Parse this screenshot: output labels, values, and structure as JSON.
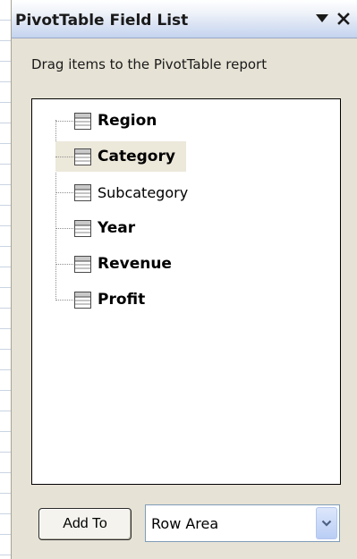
{
  "pane": {
    "title": "PivotTable Field List",
    "instructions": "Drag items to the PivotTable report"
  },
  "fields": [
    {
      "label": "Region",
      "bold": true,
      "selected": false
    },
    {
      "label": "Category",
      "bold": true,
      "selected": true
    },
    {
      "label": "Subcategory",
      "bold": false,
      "selected": false
    },
    {
      "label": "Year",
      "bold": true,
      "selected": false
    },
    {
      "label": "Revenue",
      "bold": true,
      "selected": false
    },
    {
      "label": "Profit",
      "bold": true,
      "selected": false
    }
  ],
  "footer": {
    "add_to_label": "Add To",
    "area_selected": "Row Area"
  },
  "icons": {
    "title_dropdown": "triangle-down-icon",
    "title_close": "close-icon",
    "field": "field-icon",
    "select_arrow": "chevron-down-icon"
  },
  "colors": {
    "pane_background": "#e6e2d5",
    "title_gradient_end": "#c4d3ee",
    "selected_highlight": "#ece8da",
    "grid_line": "#c9d4e2"
  }
}
